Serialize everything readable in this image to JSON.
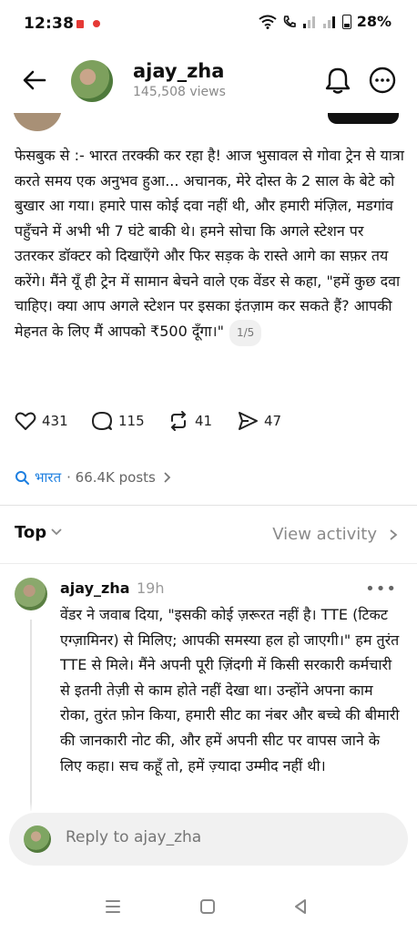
{
  "status": {
    "time": "12:38",
    "battery": "28%"
  },
  "header": {
    "username": "ajay_zha",
    "views": "145,508 views"
  },
  "post": {
    "text": "फेसबुक से :- भारत तरक्की कर रहा है! आज भुसावल से गोवा ट्रेन से यात्रा करते समय एक अनुभव हुआ... अचानक, मेरे दोस्त के 2 साल के बेटे को बुखार आ गया। हमारे पास कोई दवा नहीं थी, और हमारी मंज़िल, मडगांव पहुँचने में अभी भी 7 घंटे बाकी थे। हमने सोचा कि अगले स्टेशन पर उतरकर डॉक्टर को दिखाएँगे और फिर सड़क के रास्ते आगे का सफ़र तय करेंगे। मैंने यूँ ही ट्रेन में सामान बेचने वाले एक वेंडर से कहा, \"हमें कुछ दवा चाहिए। क्या आप अगले स्टेशन पर इसका इंतज़ाम कर सकते हैं? आपकी मेहनत के लिए मैं आपको ₹500 दूँगा।\"",
    "page_indicator": "1/5",
    "likes": "431",
    "replies": "115",
    "reposts": "41",
    "shares": "47"
  },
  "topic": {
    "name": "भारत",
    "posts": "· 66.4K posts"
  },
  "sort": {
    "label": "Top",
    "view_activity": "View activity"
  },
  "reply": {
    "username": "ajay_zha",
    "time": "19h",
    "text": "वेंडर ने जवाब दिया, \"इसकी कोई ज़रूरत नहीं है। TTE (टिकट एग्ज़ामिनर) से मिलिए; आपकी समस्या हल हो जाएगी।\" हम तुरंत TTE से मिले। मैंने अपनी पूरी ज़िंदगी में किसी सरकारी कर्मचारी से इतनी तेज़ी से काम होते नहीं देखा था। उन्होंने अपना काम रोका, तुरंत फ़ोन किया, हमारी सीट का नंबर और बच्चे की बीमारी की जानकारी नोट की, और हमें अपनी सीट पर वापस जाने के लिए कहा। सच कहूँ तो, हमें ज़्यादा उम्मीद नहीं थी।"
  },
  "composer": {
    "placeholder": "Reply to ajay_zha"
  },
  "icons": [
    "back-arrow-icon",
    "bell-icon",
    "more-icon",
    "heart-icon",
    "comment-icon",
    "repost-icon",
    "share-icon",
    "search-icon",
    "chevron-down-icon",
    "chevron-right-icon"
  ]
}
